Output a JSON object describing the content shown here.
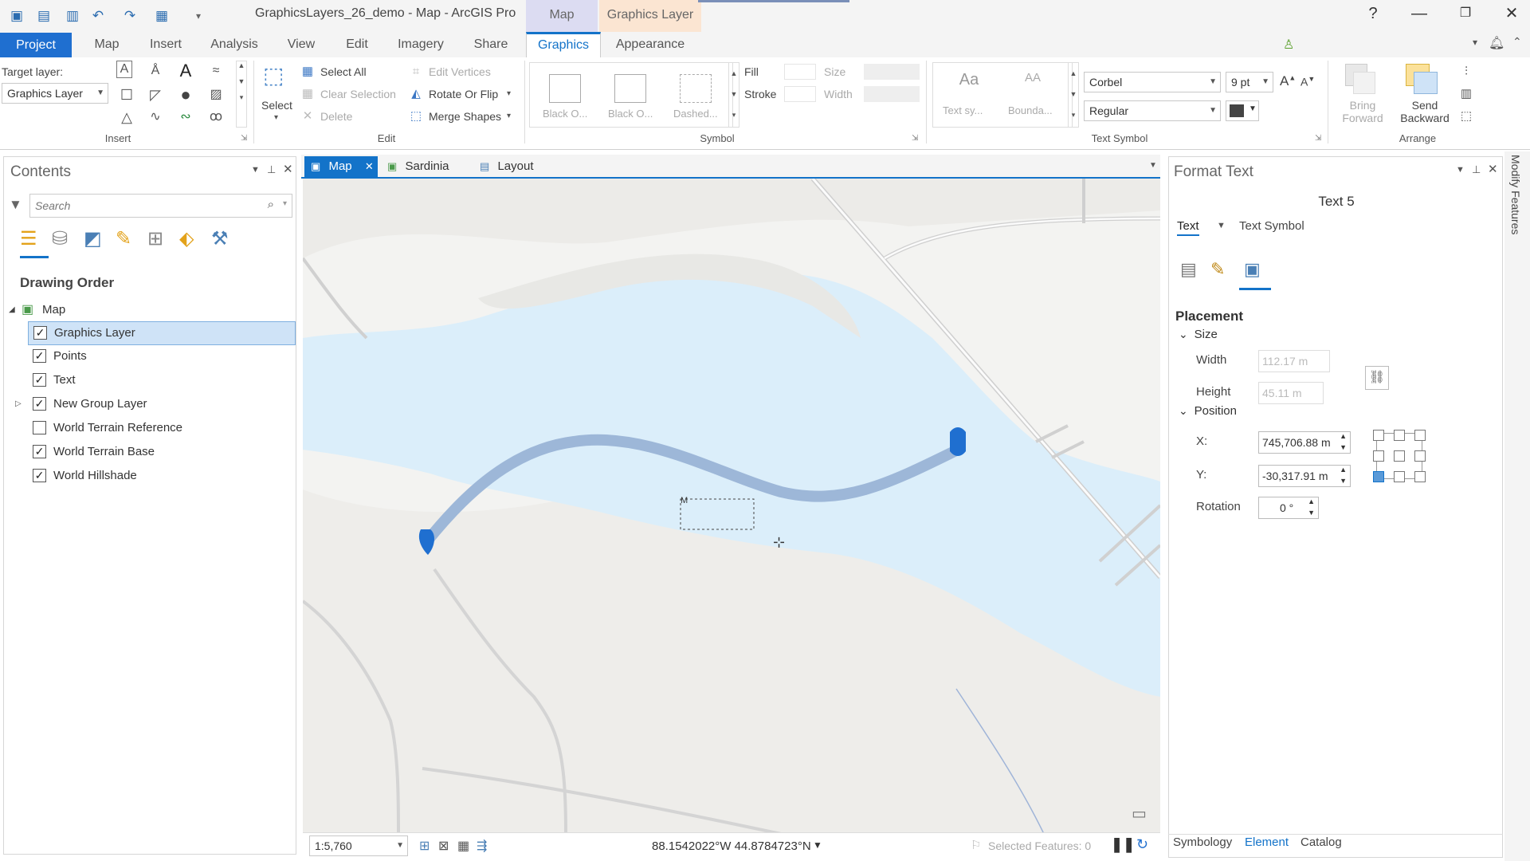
{
  "titlebar": {
    "title": "GraphicsLayers_26_demo - Map - ArcGIS Pro",
    "context_groups": [
      "Map",
      "Graphics Layer"
    ],
    "help": "?"
  },
  "ribbon_tabs": [
    "Project",
    "Map",
    "Insert",
    "Analysis",
    "View",
    "Edit",
    "Imagery",
    "Share",
    "Graphics",
    "Appearance"
  ],
  "active_tab": "Graphics",
  "ribbon": {
    "target_layer_label": "Target layer:",
    "target_layer_value": "Graphics Layer",
    "insert_label": "Insert",
    "select_label": "Select",
    "select_all": "Select All",
    "clear_selection": "Clear Selection",
    "delete": "Delete",
    "edit_vertices": "Edit Vertices",
    "rotate_or_flip": "Rotate Or Flip",
    "merge_shapes": "Merge Shapes",
    "edit_label": "Edit",
    "symbol_gallery": [
      "Black O...",
      "Black O...",
      "Dashed..."
    ],
    "fill": "Fill",
    "stroke": "Stroke",
    "size": "Size",
    "width": "Width",
    "symbol_label": "Symbol",
    "text_gallery": [
      "Text sy...",
      "Bounda..."
    ],
    "text_gallery_glyphs": [
      "Aa",
      "AA"
    ],
    "font_family": "Corbel",
    "font_size": "9 pt",
    "font_style": "Regular",
    "text_symbol_label": "Text Symbol",
    "bring_forward": [
      "Bring",
      "Forward"
    ],
    "send_backward": [
      "Send",
      "Backward"
    ],
    "arrange_label": "Arrange"
  },
  "contents": {
    "title": "Contents",
    "search_placeholder": "Search",
    "drawing_order": "Drawing Order",
    "map_name": "Map",
    "layers": [
      {
        "name": "Graphics Layer",
        "checked": true,
        "selected": true
      },
      {
        "name": "Points",
        "checked": true
      },
      {
        "name": "Text",
        "checked": true
      },
      {
        "name": "New Group Layer",
        "checked": true,
        "expandable": true
      },
      {
        "name": "World Terrain Reference",
        "checked": false
      },
      {
        "name": "World Terrain Base",
        "checked": true
      },
      {
        "name": "World Hillshade",
        "checked": true
      }
    ]
  },
  "view_tabs": [
    "Map",
    "Sardinia",
    "Layout"
  ],
  "map": {
    "text_element": "M",
    "scale": "1:5,760",
    "coordinates": "88.1542022°W 44.8784723°N",
    "selected_features": "Selected Features: 0"
  },
  "format_pane": {
    "title": "Format Text",
    "element_name": "Text 5",
    "tabs": [
      "Text",
      "Text Symbol"
    ],
    "placement": "Placement",
    "size": "Size",
    "width_label": "Width",
    "width_value": "112.17 m",
    "height_label": "Height",
    "height_value": "45.11 m",
    "position": "Position",
    "x_label": "X:",
    "x_value": "745,706.88 m",
    "y_label": "Y:",
    "y_value": "-30,317.91 m",
    "rotation_label": "Rotation",
    "rotation_value": "0 °"
  },
  "bottom_tabs": [
    "Symbology",
    "Element",
    "Catalog"
  ],
  "right_strip": "Modify Features",
  "colors": {
    "accent": "#1373c9",
    "water": "#dbeefa",
    "line": "#9db7d8"
  }
}
